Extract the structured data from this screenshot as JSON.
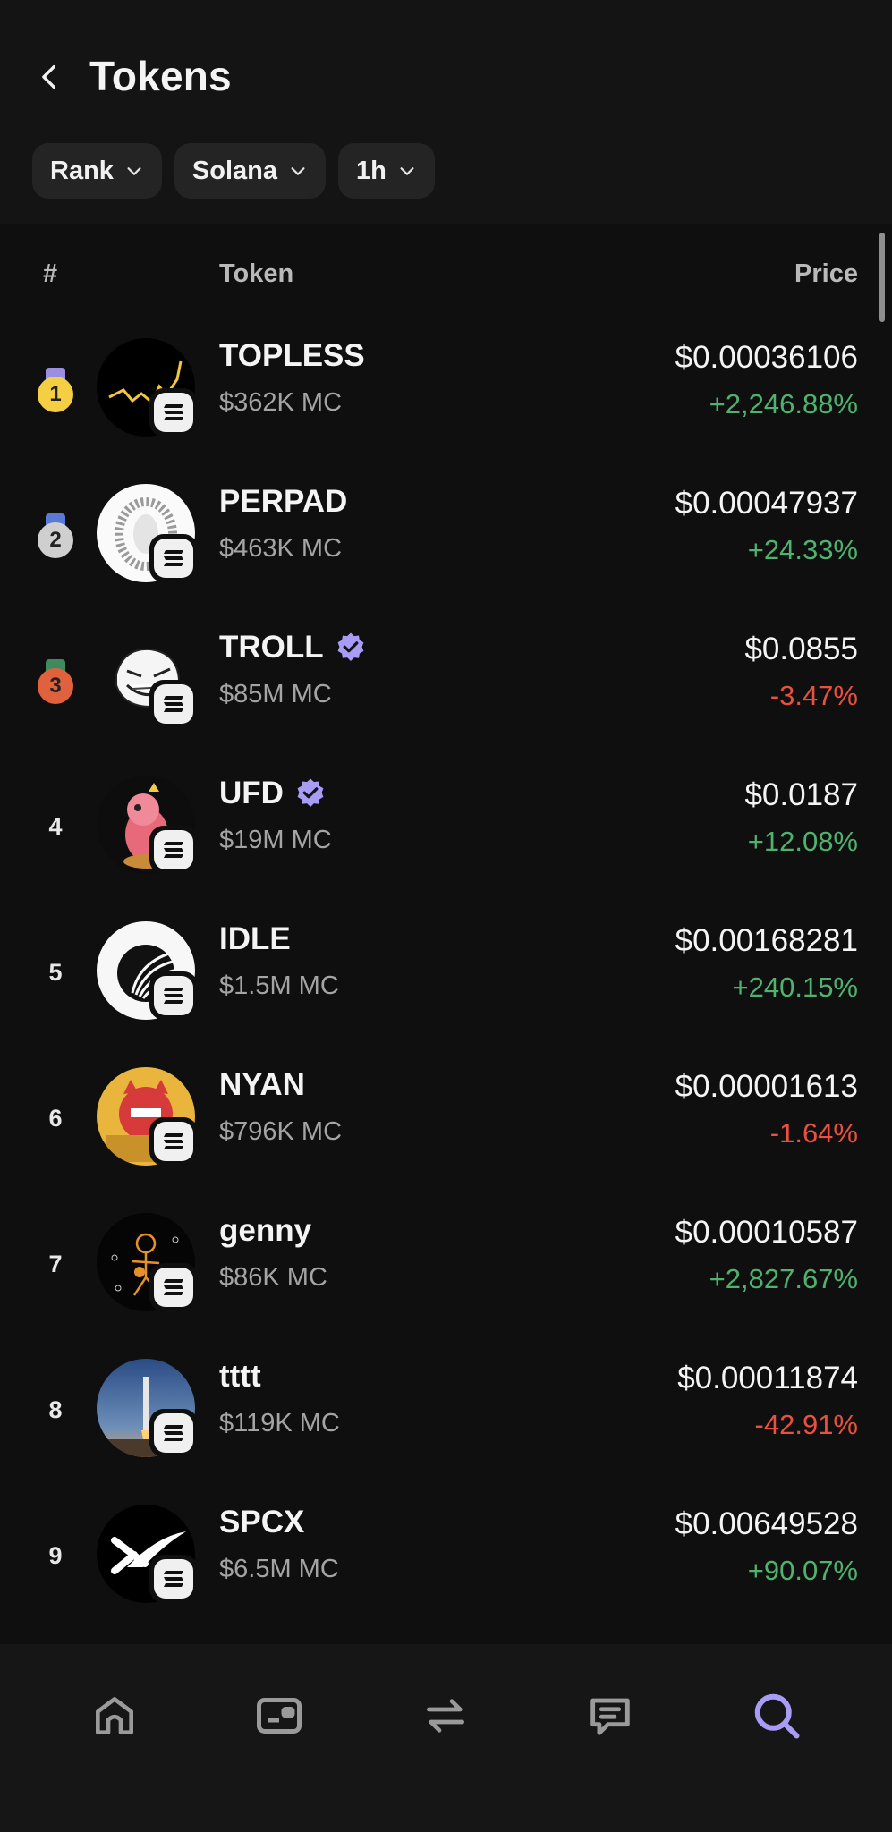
{
  "header": {
    "title": "Tokens",
    "filters": [
      {
        "label": "Rank"
      },
      {
        "label": "Solana"
      },
      {
        "label": "1h"
      }
    ]
  },
  "table": {
    "columns": {
      "rank": "#",
      "token": "Token",
      "price": "Price"
    },
    "rows": [
      {
        "rank": "1",
        "name": "TOPLESS",
        "mc": "$362K MC",
        "price": "$0.00036106",
        "change": "+2,246.88%",
        "verified": false
      },
      {
        "rank": "2",
        "name": "PERPAD",
        "mc": "$463K MC",
        "price": "$0.00047937",
        "change": "+24.33%",
        "verified": false
      },
      {
        "rank": "3",
        "name": "TROLL",
        "mc": "$85M MC",
        "price": "$0.0855",
        "change": "-3.47%",
        "verified": true
      },
      {
        "rank": "4",
        "name": "UFD",
        "mc": "$19M MC",
        "price": "$0.0187",
        "change": "+12.08%",
        "verified": true
      },
      {
        "rank": "5",
        "name": "IDLE",
        "mc": "$1.5M MC",
        "price": "$0.00168281",
        "change": "+240.15%",
        "verified": false
      },
      {
        "rank": "6",
        "name": "NYAN",
        "mc": "$796K MC",
        "price": "$0.00001613",
        "change": "-1.64%",
        "verified": false
      },
      {
        "rank": "7",
        "name": "genny",
        "mc": "$86K MC",
        "price": "$0.00010587",
        "change": "+2,827.67%",
        "verified": false
      },
      {
        "rank": "8",
        "name": "tttt",
        "mc": "$119K MC",
        "price": "$0.00011874",
        "change": "-42.91%",
        "verified": false
      },
      {
        "rank": "9",
        "name": "SPCX",
        "mc": "$6.5M MC",
        "price": "$0.00649528",
        "change": "+90.07%",
        "verified": false
      }
    ]
  },
  "colors": {
    "positive": "#4fb26e",
    "negative": "#e8503f",
    "accent": "#a89cf5",
    "gold": "#f5cf43",
    "silver": "#cfcfcf",
    "bronze": "#e0613d"
  },
  "nav": {
    "items": [
      {
        "icon": "home-icon",
        "active": false
      },
      {
        "icon": "wallet-icon",
        "active": false
      },
      {
        "icon": "swap-icon",
        "active": false
      },
      {
        "icon": "chat-icon",
        "active": false
      },
      {
        "icon": "search-icon",
        "active": true
      }
    ]
  }
}
